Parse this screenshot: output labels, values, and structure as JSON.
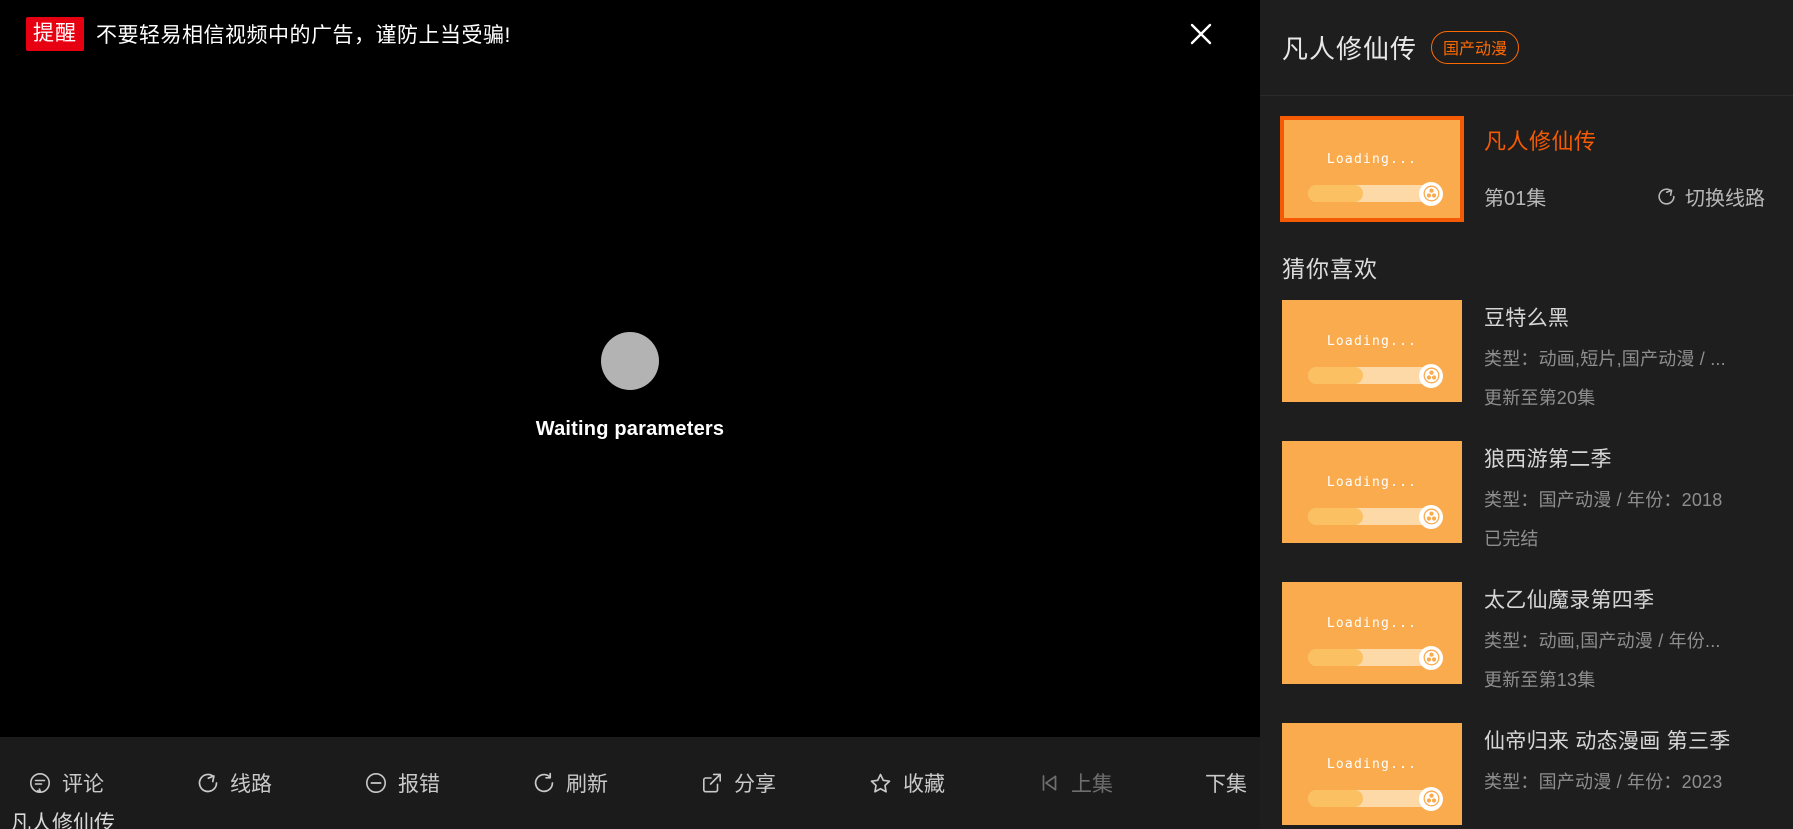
{
  "warning": {
    "tag": "提醒",
    "text": "不要轻易相信视频中的广告，谨防上当受骗!",
    "close_icon": "close-icon"
  },
  "player": {
    "status_text": "Waiting parameters",
    "controls": [
      {
        "icon": "comment-icon",
        "label": "评论",
        "dim": false
      },
      {
        "icon": "route-icon",
        "label": "线路",
        "dim": false
      },
      {
        "icon": "report-icon",
        "label": "报错",
        "dim": false
      },
      {
        "icon": "refresh-icon",
        "label": "刷新",
        "dim": false
      },
      {
        "icon": "share-icon",
        "label": "分享",
        "dim": false
      },
      {
        "icon": "star-icon",
        "label": "收藏",
        "dim": false
      },
      {
        "icon": "prev-icon",
        "label": "上集",
        "dim": true
      },
      {
        "icon": "next-icon",
        "label": "下集",
        "dim": false
      }
    ]
  },
  "page_bottom_text": "凡人修仙传",
  "sidebar": {
    "title": "凡人修仙传",
    "badge": "国产动漫",
    "featured": {
      "thumb_text": "Loading...",
      "name": "凡人修仙传",
      "episode": "第01集",
      "switch_label": "切换线路",
      "switch_icon": "switch-route-icon"
    },
    "recommend_title": "猜你喜欢",
    "recommendations": [
      {
        "thumb_text": "Loading...",
        "name": "豆特么黑",
        "meta": "类型：动画,短片,国产动漫 / ...",
        "status": "更新至第20集"
      },
      {
        "thumb_text": "Loading...",
        "name": "狼西游第二季",
        "meta": "类型：国产动漫 / 年份：2018",
        "status": "已完结"
      },
      {
        "thumb_text": "Loading...",
        "name": "太乙仙魔录第四季",
        "meta": "类型：动画,国产动漫 / 年份...",
        "status": "更新至第13集"
      },
      {
        "thumb_text": "Loading...",
        "name": "仙帝归来 动态漫画 第三季",
        "meta": "类型：国产动漫 / 年份：2023",
        "status": ""
      }
    ]
  },
  "colors": {
    "accent_orange": "#f45b04",
    "badge_orange": "#ff6a00",
    "warn_red": "#e60012",
    "thumb_orange": "#f9ab4e",
    "sidebar_bg": "#1e1e1e",
    "player_bg": "#000000",
    "chrome_bg": "#1b1b1b"
  }
}
